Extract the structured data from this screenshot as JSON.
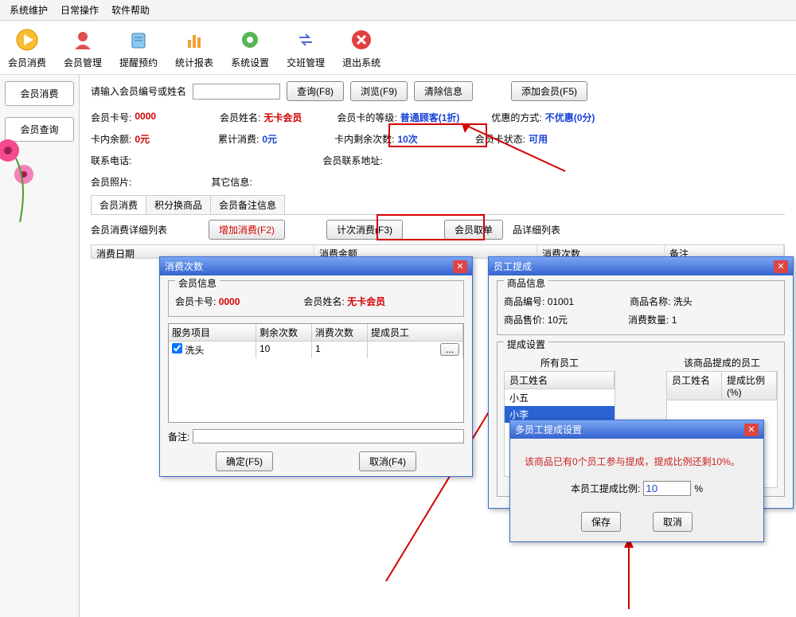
{
  "menu": {
    "items": [
      "系统维护",
      "日常操作",
      "软件帮助"
    ]
  },
  "toolbar": [
    {
      "label": "会员消费"
    },
    {
      "label": "会员管理"
    },
    {
      "label": "提醒预约"
    },
    {
      "label": "统计报表"
    },
    {
      "label": "系统设置"
    },
    {
      "label": "交班管理"
    },
    {
      "label": "退出系统"
    }
  ],
  "side": {
    "btn1": "会员消费",
    "btn2": "会员查询"
  },
  "search": {
    "label": "请输入会员编号或姓名",
    "query": "查询(F8)",
    "browse": "浏览(F9)",
    "clear": "清除信息",
    "add": "添加会员(F5)"
  },
  "member": {
    "row1": {
      "card_no_l": "会员卡号:",
      "card_no": "0000",
      "name_l": "会员姓名:",
      "name": "无卡会员",
      "level_l": "会员卡的等级:",
      "level": "普通顾客(1折)",
      "pref_l": "优惠的方式:",
      "pref": "不优惠(0分)"
    },
    "row2": {
      "balance_l": "卡内余额:",
      "balance": "0元",
      "total_l": "累计消费:",
      "total": "0元",
      "remain_l": "卡内剩余次数:",
      "remain": "10次",
      "status_l": "会员卡状态:",
      "status": "可用"
    },
    "row3": {
      "phone_l": "联系电话:",
      "addr_l": "会员联系地址:"
    },
    "row4": {
      "photo_l": "会员照片:",
      "other_l": "其它信息:"
    }
  },
  "tabs": {
    "t1": "会员消费",
    "t2": "积分换商品",
    "t3": "会员备注信息"
  },
  "sub": {
    "list_l": "会员消费详细列表",
    "add": "增加消费(F2)",
    "count": "计次消费(F3)",
    "cancel": "会员取单",
    "goods": "品详细列表"
  },
  "table_cols": {
    "c1": "消费日期",
    "c2": "消费金额",
    "c3": "消费次数",
    "c4": "备注"
  },
  "dialog1": {
    "title": "消费次数",
    "group": "会员信息",
    "card_l": "会员卡号:",
    "card": "0000",
    "name_l": "会员姓名:",
    "name": "无卡会员",
    "cols": {
      "c1": "服务项目",
      "c2": "剩余次数",
      "c3": "消费次数",
      "c4": "提成员工"
    },
    "row": {
      "item": "洗头",
      "remain": "10",
      "consume": "1",
      "staff": "..."
    },
    "note_l": "备注:",
    "ok": "确定(F5)",
    "cancel": "取消(F4)"
  },
  "dialog2": {
    "title": "员工提成",
    "group1": "商品信息",
    "pid_l": "商品编号:",
    "pid": "01001",
    "pname_l": "商品名称:",
    "pname": "洗头",
    "price_l": "商品售价:",
    "price": "10元",
    "qty_l": "消费数量:",
    "qty": "1",
    "group2": "提成设置",
    "left_title": "所有员工",
    "right_title": "该商品提成的员工",
    "left_cols": {
      "c1": "员工姓名"
    },
    "right_cols": {
      "c1": "员工姓名",
      "c2": "提成比例(%)"
    },
    "staff": [
      "小五",
      "小李"
    ]
  },
  "dialog3": {
    "title": "多员工提成设置",
    "note": "该商品已有0个员工参与提成，提成比例还剩10%。",
    "ratio_l": "本员工提成比例:",
    "ratio": "10",
    "unit": "%",
    "save": "保存",
    "cancel": "取消"
  }
}
